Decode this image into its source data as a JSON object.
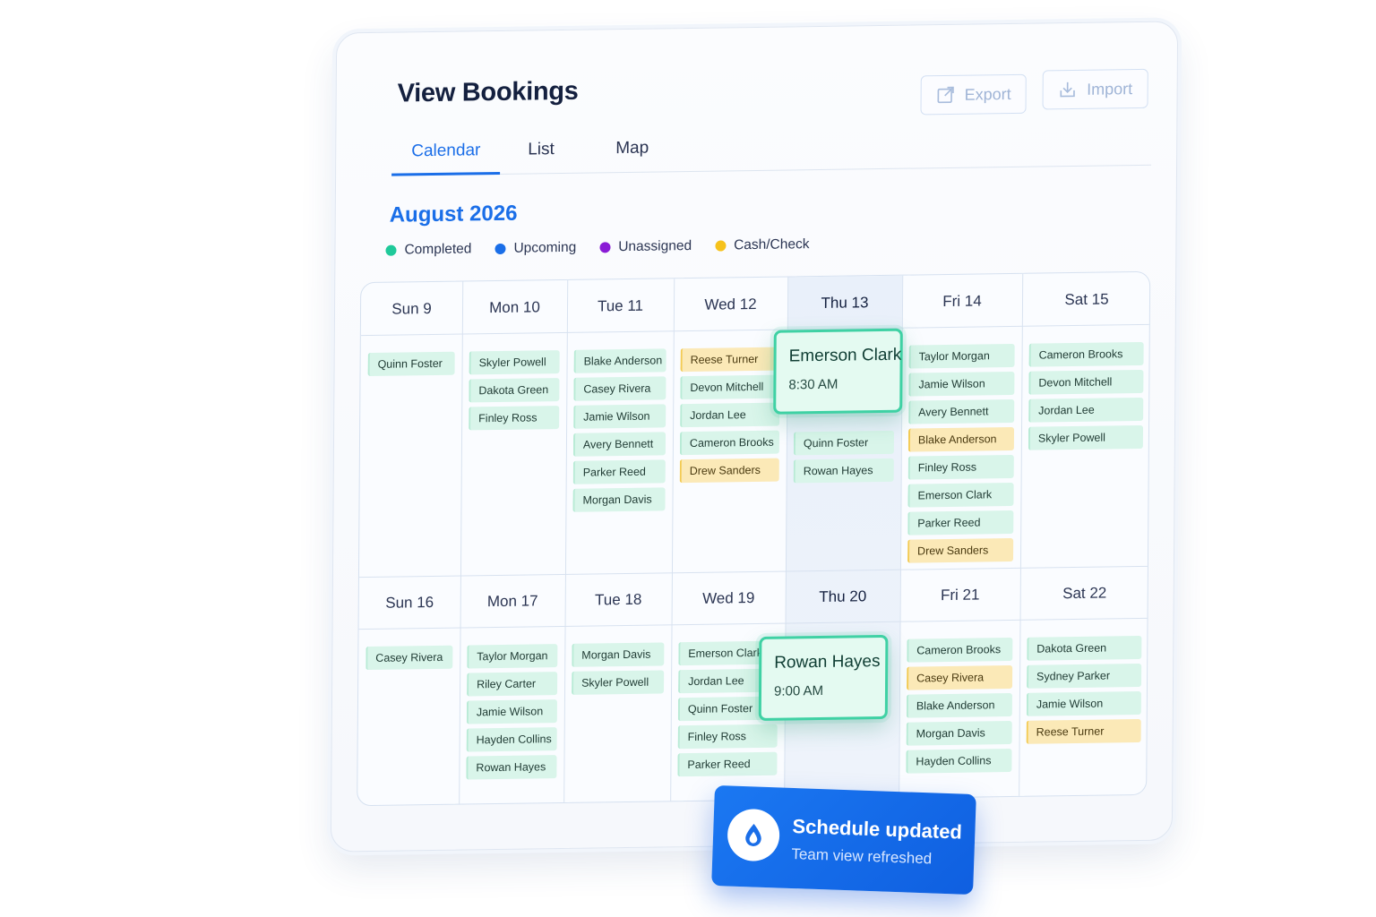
{
  "header": {
    "title": "View Bookings",
    "export_label": "Export",
    "import_label": "Import"
  },
  "tabs": [
    {
      "label": "Calendar",
      "active": true
    },
    {
      "label": "List",
      "active": false
    },
    {
      "label": "Map",
      "active": false
    }
  ],
  "month": "August 2026",
  "legend": [
    {
      "label": "Completed",
      "color": "#1fc99a"
    },
    {
      "label": "Upcoming",
      "color": "#1a6ee8"
    },
    {
      "label": "Unassigned",
      "color": "#8a1bd6"
    },
    {
      "label": "Cash/Check",
      "color": "#f6c21c"
    }
  ],
  "weeks": [
    {
      "days": [
        {
          "label": "Sun 9",
          "bookings": [
            {
              "name": "Quinn Foster"
            }
          ]
        },
        {
          "label": "Mon 10",
          "bookings": [
            {
              "name": "Skyler Powell"
            },
            {
              "name": "Dakota Green"
            },
            {
              "name": "Finley Ross"
            }
          ]
        },
        {
          "label": "Tue 11",
          "bookings": [
            {
              "name": "Blake Anderson"
            },
            {
              "name": "Casey Rivera"
            },
            {
              "name": "Jamie Wilson"
            },
            {
              "name": "Avery Bennett"
            },
            {
              "name": "Parker Reed"
            },
            {
              "name": "Morgan Davis"
            }
          ]
        },
        {
          "label": "Wed 12",
          "bookings": [
            {
              "name": "Reese Turner",
              "cash": true
            },
            {
              "name": "Devon Mitchell"
            },
            {
              "name": "Jordan Lee"
            },
            {
              "name": "Cameron Brooks"
            },
            {
              "name": "Drew Sanders",
              "cash": true
            }
          ]
        },
        {
          "label": "Thu 13",
          "today": true,
          "bookings": [
            {
              "name": "Quinn Foster"
            },
            {
              "name": "Rowan Hayes"
            }
          ],
          "popup": {
            "name": "Emerson Clark",
            "time": "8:30 AM"
          }
        },
        {
          "label": "Fri 14",
          "bookings": [
            {
              "name": "Taylor Morgan"
            },
            {
              "name": "Jamie Wilson"
            },
            {
              "name": "Avery Bennett"
            },
            {
              "name": "Blake Anderson",
              "cash": true
            },
            {
              "name": "Finley Ross"
            },
            {
              "name": "Emerson Clark"
            },
            {
              "name": "Parker Reed"
            },
            {
              "name": "Drew Sanders",
              "cash": true
            }
          ]
        },
        {
          "label": "Sat 15",
          "bookings": [
            {
              "name": "Cameron Brooks"
            },
            {
              "name": "Devon Mitchell"
            },
            {
              "name": "Jordan Lee"
            },
            {
              "name": "Skyler Powell"
            }
          ]
        }
      ]
    },
    {
      "days": [
        {
          "label": "Sun 16",
          "bookings": [
            {
              "name": "Casey Rivera"
            }
          ]
        },
        {
          "label": "Mon 17",
          "bookings": [
            {
              "name": "Taylor Morgan"
            },
            {
              "name": "Riley Carter"
            },
            {
              "name": "Jamie Wilson"
            },
            {
              "name": "Hayden Collins"
            },
            {
              "name": "Rowan Hayes"
            }
          ]
        },
        {
          "label": "Tue 18",
          "bookings": [
            {
              "name": "Morgan Davis"
            },
            {
              "name": "Skyler Powell"
            }
          ]
        },
        {
          "label": "Wed 19",
          "bookings": [
            {
              "name": "Emerson Clark"
            },
            {
              "name": "Jordan Lee"
            },
            {
              "name": "Quinn Foster"
            },
            {
              "name": "Finley Ross"
            },
            {
              "name": "Parker Reed"
            }
          ]
        },
        {
          "label": "Thu 20",
          "today": true,
          "bookings": [],
          "popup": {
            "name": "Rowan Hayes",
            "time": "9:00 AM"
          }
        },
        {
          "label": "Fri 21",
          "bookings": [
            {
              "name": "Cameron Brooks"
            },
            {
              "name": "Casey Rivera",
              "cash": true
            },
            {
              "name": "Blake Anderson"
            },
            {
              "name": "Morgan Davis"
            },
            {
              "name": "Hayden Collins"
            }
          ]
        },
        {
          "label": "Sat 22",
          "bookings": [
            {
              "name": "Dakota Green"
            },
            {
              "name": "Sydney Parker"
            },
            {
              "name": "Jamie Wilson"
            },
            {
              "name": "Reese Turner",
              "cash": true
            }
          ]
        }
      ]
    }
  ],
  "toast": {
    "title": "Schedule updated",
    "subtitle": "Team view refreshed",
    "icon": "water-drop-icon"
  }
}
